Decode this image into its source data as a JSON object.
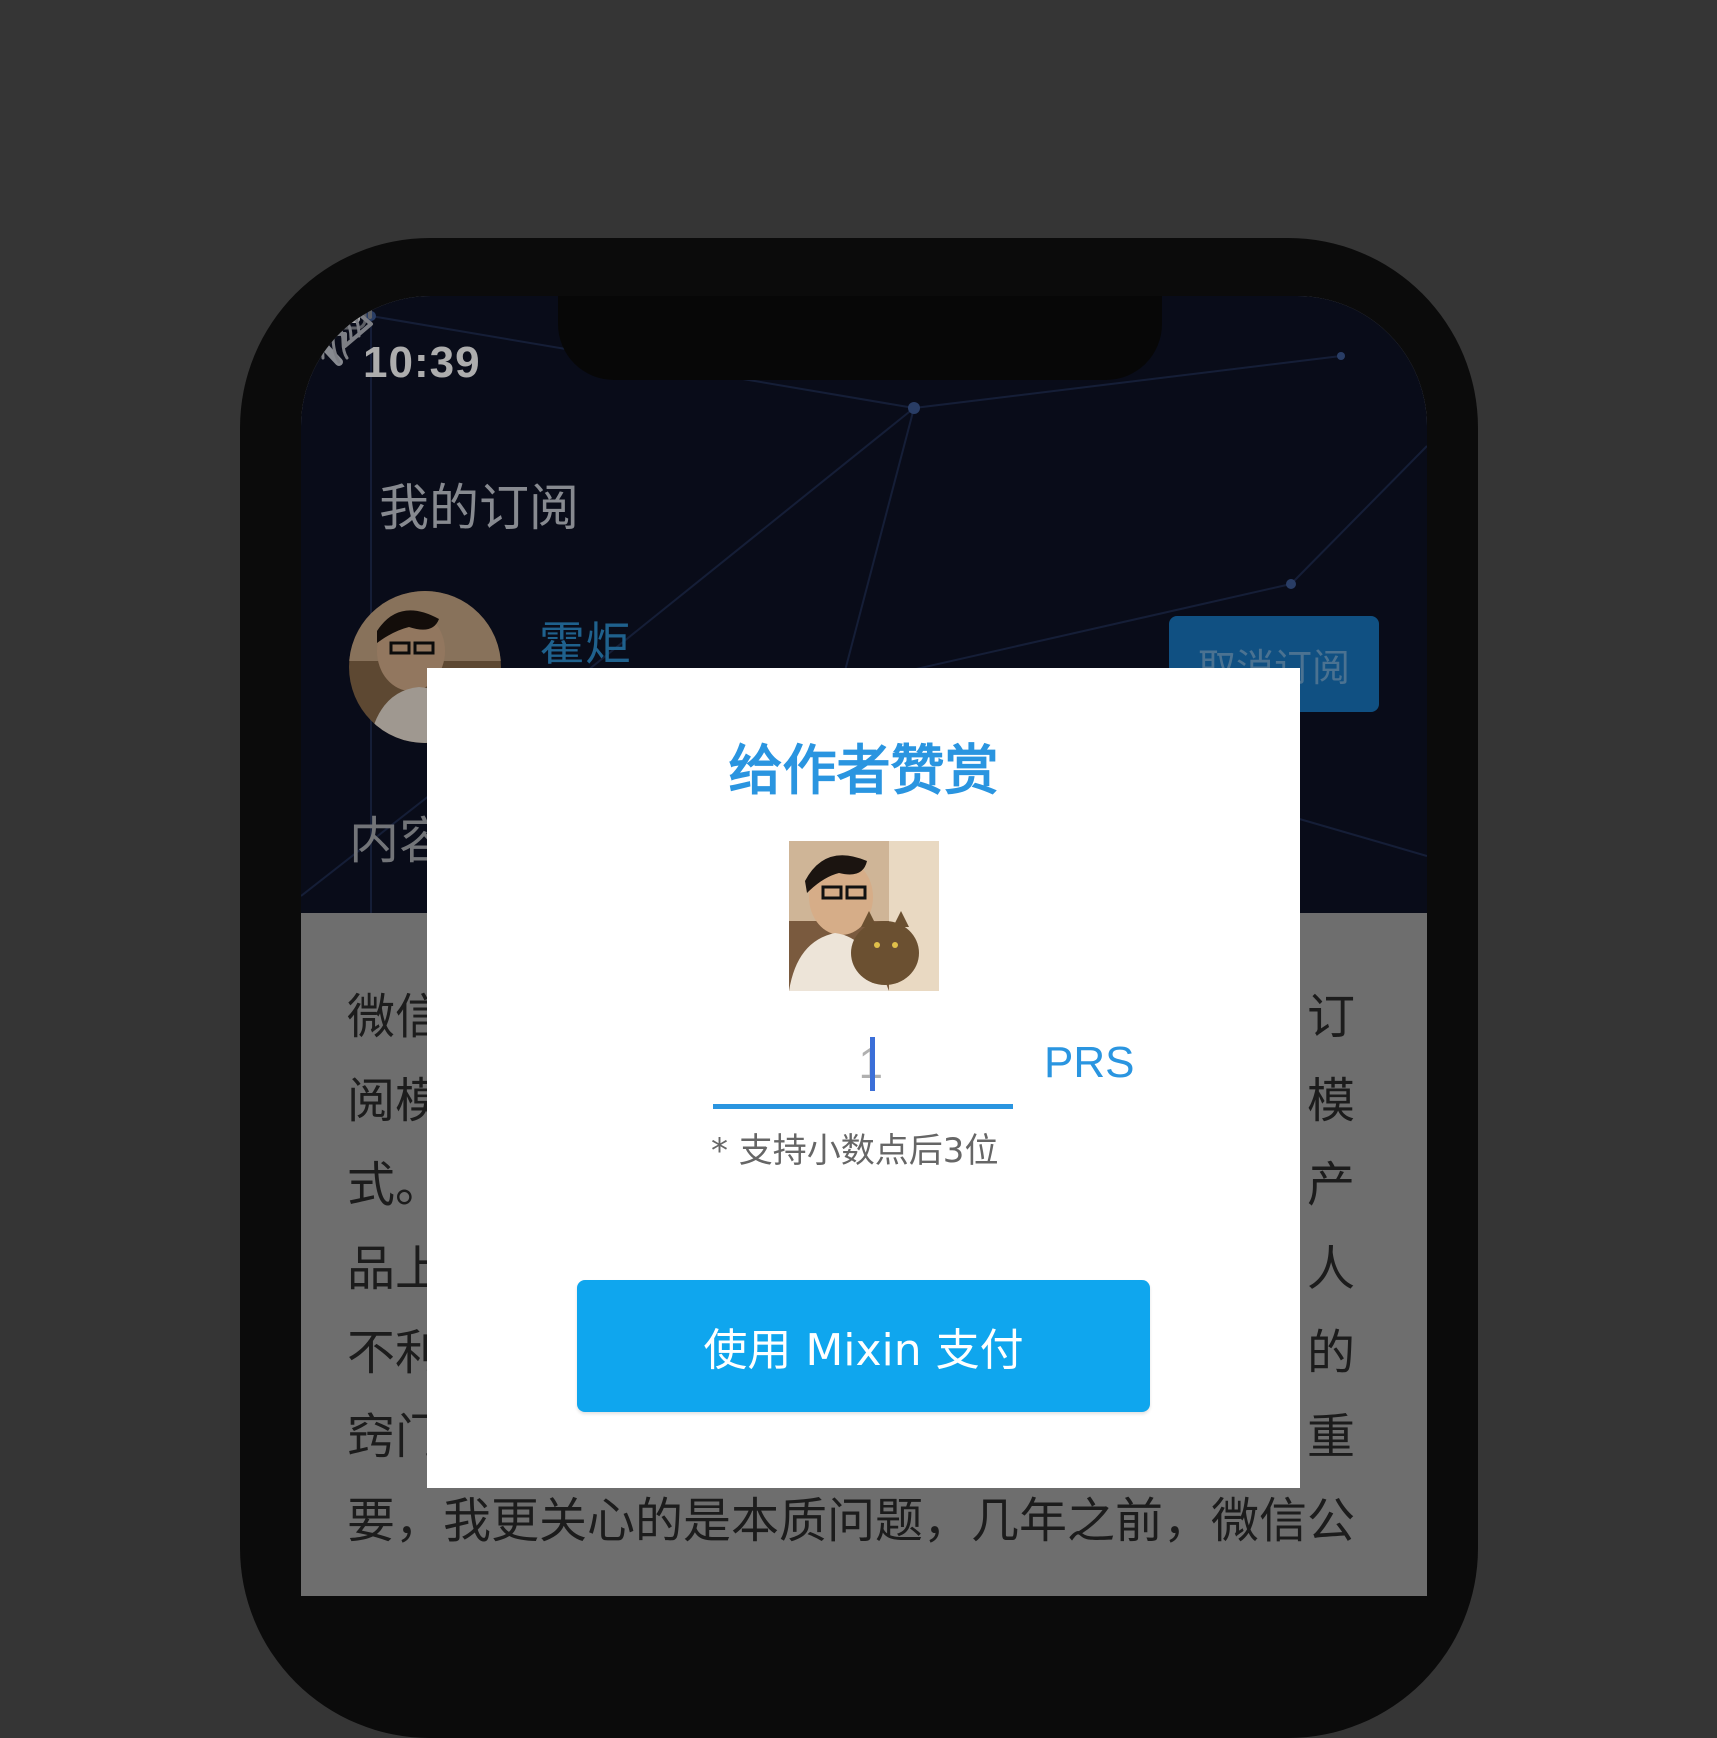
{
  "status_bar": {
    "time": "10:39",
    "icons": [
      "location-arrow-icon",
      "signal-icon",
      "wifi-icon",
      "battery-icon"
    ]
  },
  "nav": {
    "back_label": "我的订阅",
    "icons": [
      "back-chevron-icon",
      "fingerprint-icon",
      "share-icon"
    ]
  },
  "author": {
    "name": "霍炬",
    "unsubscribe_label": "取消订阅"
  },
  "tab": {
    "label": "内容"
  },
  "article": {
    "left_fragments": [
      "微信",
      "阅模",
      "式。",
      "品上",
      "不利",
      "窍门"
    ],
    "right_fragments": [
      "订",
      "模",
      "产",
      "人",
      "的",
      "重"
    ],
    "last_line": "要，我更关心的是本质问题，几年之前，微信公"
  },
  "modal": {
    "title": "给作者赞赏",
    "amount_value": "1",
    "currency": "PRS",
    "hint": "* 支持小数点后3位",
    "pay_button_label": "使用 Mixin 支付"
  },
  "colors": {
    "accent": "#2a95e0",
    "pay_button": "#0fa6ee",
    "background": "#353535",
    "header": "#0e1326"
  }
}
